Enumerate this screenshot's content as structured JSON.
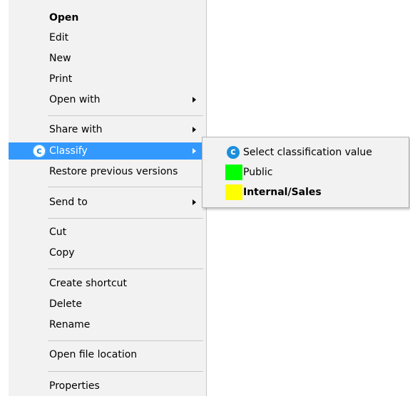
{
  "menu": {
    "items": [
      {
        "label": "Open",
        "bold": true
      },
      {
        "label": "Edit"
      },
      {
        "label": "New"
      },
      {
        "label": "Print"
      },
      {
        "label": "Open with",
        "submenu": true
      },
      {
        "label": "Share with",
        "submenu": true
      },
      {
        "label": "Classify",
        "submenu": true,
        "selected": true,
        "icon": "classify-icon",
        "icon_glyph": "c"
      },
      {
        "label": "Restore previous versions"
      },
      {
        "label": "Send to",
        "submenu": true
      },
      {
        "label": "Cut"
      },
      {
        "label": "Copy"
      },
      {
        "label": "Create shortcut"
      },
      {
        "label": "Delete"
      },
      {
        "label": "Rename"
      },
      {
        "label": "Open file location"
      },
      {
        "label": "Properties"
      }
    ]
  },
  "submenu": {
    "items": [
      {
        "label": "Select classification value",
        "icon": "classify-icon",
        "icon_glyph": "c"
      },
      {
        "label": "Public",
        "swatch_color": "#00ff00"
      },
      {
        "label": "Internal/Sales",
        "swatch_color": "#ffff00",
        "bold": true
      }
    ]
  },
  "colors": {
    "selection": "#3399ff",
    "menu_background": "#f2f2f2",
    "classify_icon": "#1a8fdc"
  }
}
